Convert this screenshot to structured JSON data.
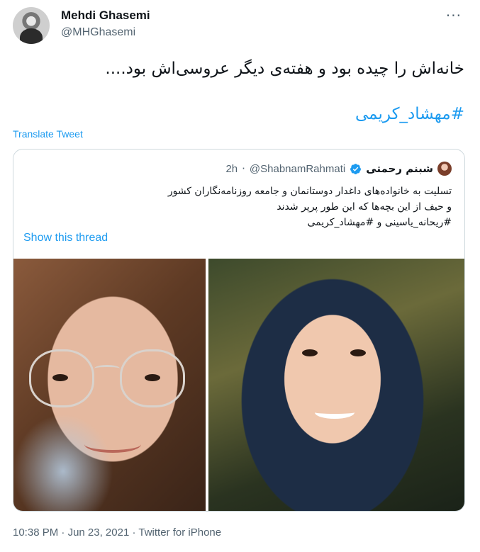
{
  "author": {
    "name": "Mehdi Ghasemi",
    "handle": "@MHGhasemi"
  },
  "more_label": "···",
  "tweet": {
    "text": "خانه‌اش را چیده بود و هفته‌ی دیگر عروسی‌اش بود....",
    "hashtag": "#مهشاد_کریمی"
  },
  "translate_label": "Translate Tweet",
  "quote": {
    "name": "شبنم رحمتی",
    "handle": "@ShabnamRahmati",
    "separator": "·",
    "time": "2h",
    "lines": [
      "تسلیت به خانواده‌های داغدار دوستانمان و جامعه روزنامه‌نگاران کشور",
      "و حیف از این بچه‌ها که این طور پرپر شدند",
      "#ریحانه_یاسینی و #مهشاد_کریمی"
    ],
    "show_thread": "Show this thread"
  },
  "meta": {
    "time": "10:38 PM",
    "sep1": " · ",
    "date": "Jun 23, 2021",
    "sep2": " · ",
    "source": "Twitter for iPhone"
  },
  "colors": {
    "link": "#1d9bf0",
    "muted": "#536471",
    "text": "#0f1419",
    "border": "#cfd9de"
  }
}
